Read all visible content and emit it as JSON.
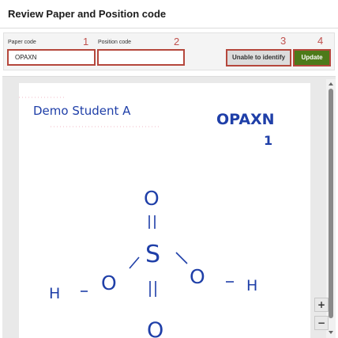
{
  "header": {
    "title": "Review Paper and Position code"
  },
  "form": {
    "paper_code_label": "Paper code",
    "paper_code_value": "OPAXN",
    "position_code_label": "Position code",
    "position_code_value": "",
    "unable_label": "Unable to identify",
    "update_label": "Update"
  },
  "callouts": [
    "1",
    "2",
    "3",
    "4"
  ],
  "scan": {
    "student_name": "Demo Student A",
    "paper_code_written": "OPAXN",
    "position_written": "1",
    "molecule": {
      "center": "S",
      "top_o": "O",
      "bottom_o": "O",
      "left_o": "O",
      "right_o": "O",
      "left_h": "H",
      "right_h": "H"
    }
  },
  "zoom": {
    "in_label": "+",
    "out_label": "−"
  },
  "colors": {
    "accent_border": "#b5473c",
    "update_bg": "#4d7a1a",
    "ink": "#1f3fa8"
  },
  "icons": [
    "chevron-up-icon",
    "chevron-down-icon"
  ]
}
